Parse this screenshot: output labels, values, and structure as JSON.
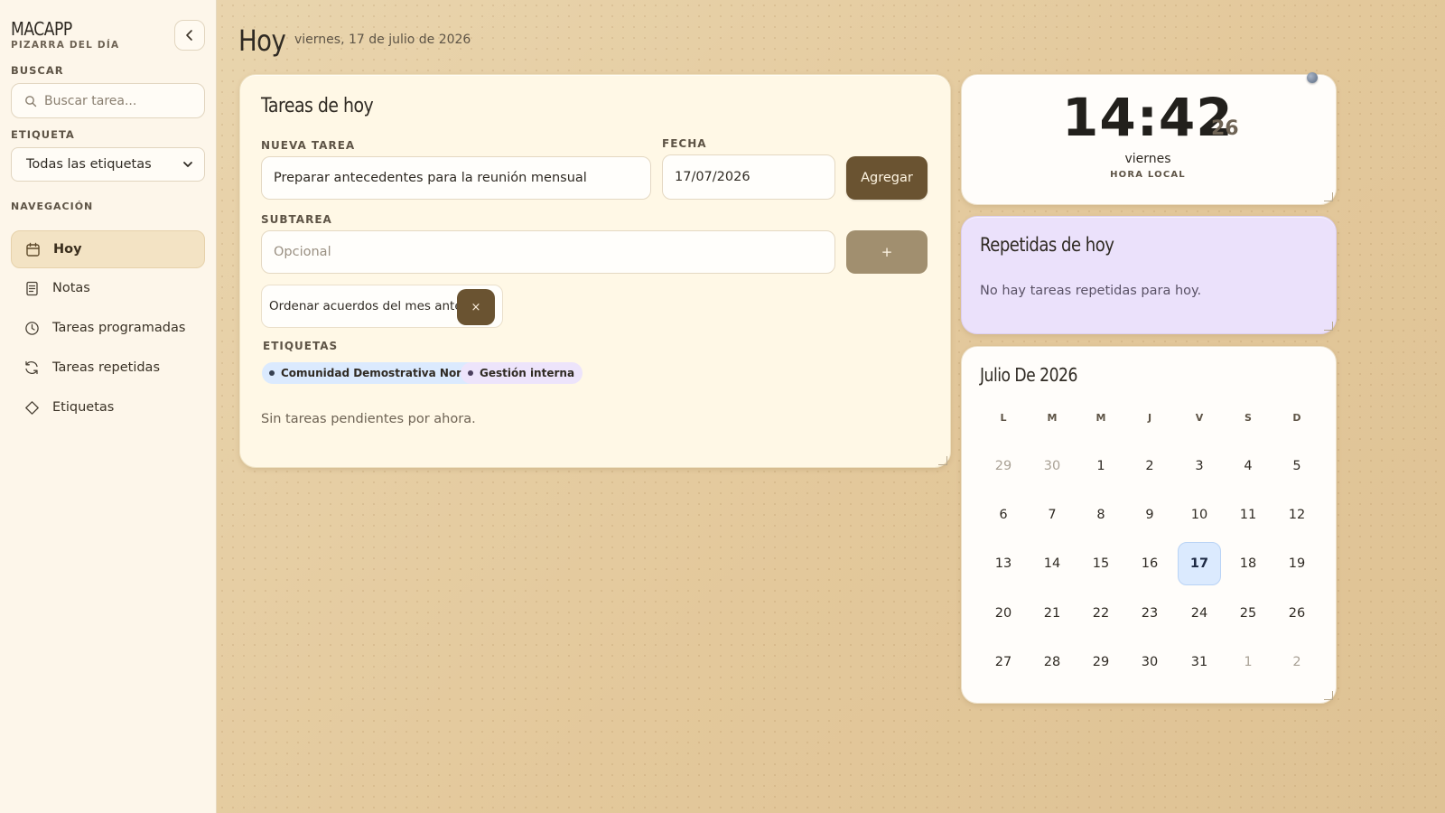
{
  "sidebar": {
    "brand_title": "MACAPP",
    "brand_subtitle": "PIZARRA DEL DÍA",
    "search_label": "BUSCAR",
    "search_placeholder": "Buscar tarea...",
    "tag_label": "ETIQUETA",
    "tag_selected": "Todas las etiquetas",
    "nav_label": "NAVEGACIÓN",
    "items": [
      {
        "label": "Hoy",
        "icon": "calendar-icon",
        "active": true
      },
      {
        "label": "Notas",
        "icon": "document-icon",
        "active": false
      },
      {
        "label": "Tareas programadas",
        "icon": "clock-icon",
        "active": false
      },
      {
        "label": "Tareas repetidas",
        "icon": "repeat-icon",
        "active": false
      },
      {
        "label": "Etiquetas",
        "icon": "tag-icon",
        "active": false
      }
    ]
  },
  "header": {
    "title": "Hoy",
    "date": "viernes, 17 de julio de 2026"
  },
  "tasks": {
    "title": "Tareas de hoy",
    "new_task_label": "NUEVA TAREA",
    "new_task_value": "Preparar antecedentes para la reunión mensual",
    "date_label": "FECHA",
    "date_value": "17/07/2026",
    "add_button": "Agregar",
    "subtask_label": "SUBTAREA",
    "subtask_placeholder": "Opcional",
    "subtask_add_button": "+",
    "subtasks": [
      {
        "text": "Ordenar acuerdos del mes anterior",
        "remove": "×"
      }
    ],
    "tags_label": "ETIQUETAS",
    "tags": [
      {
        "label": "Comunidad Demostrativa Norte",
        "color": "#dbeafe",
        "dot": "#374151"
      },
      {
        "label": "Gestión interna",
        "color": "#ede4fb",
        "dot": "#4b3f5e"
      }
    ],
    "empty_text": "Sin tareas pendientes por ahora."
  },
  "clock": {
    "time": "14:42",
    "seconds": "26",
    "day": "viernes",
    "caption": "HORA LOCAL"
  },
  "repeated": {
    "title": "Repetidas de hoy",
    "empty_text": "No hay tareas repetidas para hoy."
  },
  "calendar": {
    "title": "Julio De 2026",
    "weekdays": [
      "L",
      "M",
      "M",
      "J",
      "V",
      "S",
      "D"
    ],
    "weeks": [
      [
        "29",
        "30",
        "1",
        "2",
        "3",
        "4",
        "5"
      ],
      [
        "6",
        "7",
        "8",
        "9",
        "10",
        "11",
        "12"
      ],
      [
        "13",
        "14",
        "15",
        "16",
        "17",
        "18",
        "19"
      ],
      [
        "20",
        "21",
        "22",
        "23",
        "24",
        "25",
        "26"
      ],
      [
        "27",
        "28",
        "29",
        "30",
        "31",
        "1",
        "2"
      ]
    ],
    "today": "17",
    "accent_today": "#dbeafe"
  },
  "colors": {
    "sidebar_bg": "#fdf6ea",
    "primary_button": "#6a5331",
    "secondary_button": "#a18f6f",
    "tasks_card_bg": "#fff8e6",
    "repeated_card_bg": "#ebe1fb",
    "active_nav_bg": "#f3e3c4"
  }
}
